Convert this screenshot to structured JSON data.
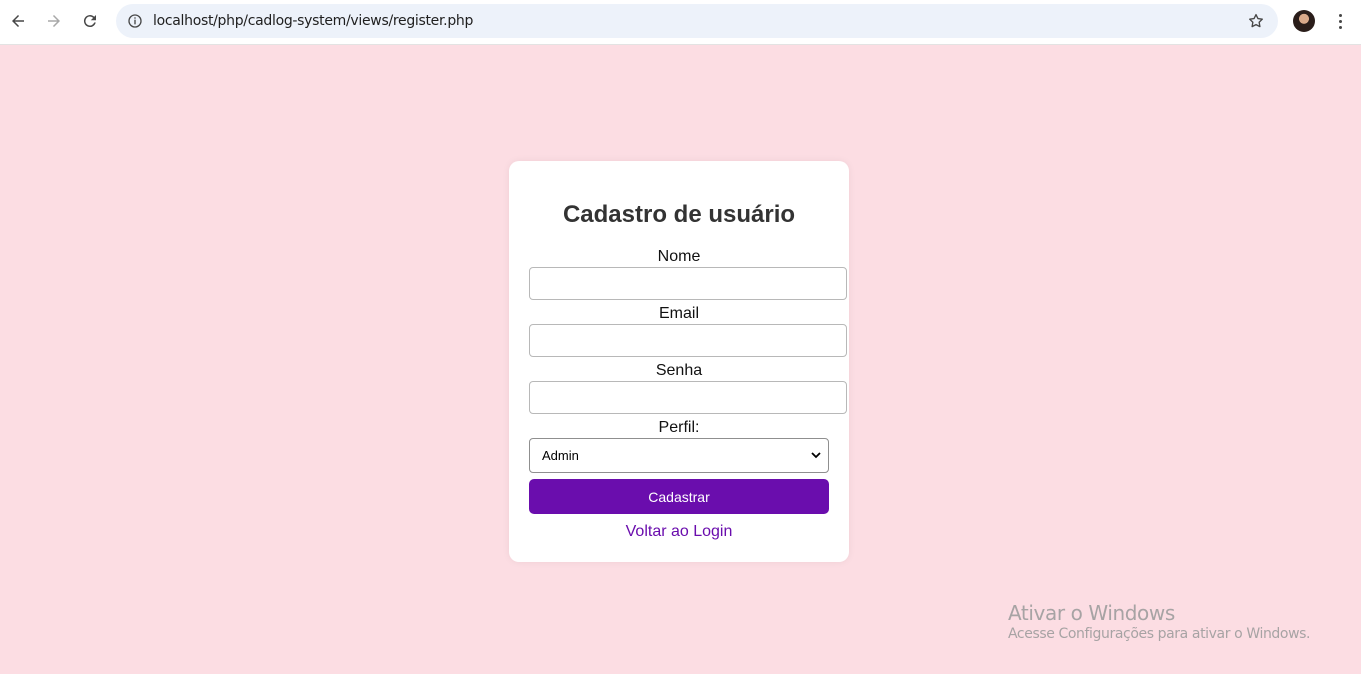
{
  "browser": {
    "url": "localhost/php/cadlog-system/views/register.php"
  },
  "form": {
    "title": "Cadastro de usuário",
    "name_label": "Nome",
    "name_value": "",
    "email_label": "Email",
    "email_value": "",
    "password_label": "Senha",
    "password_value": "",
    "profile_label": "Perfil:",
    "profile_selected": "Admin",
    "submit_label": "Cadastrar",
    "back_link": "Voltar ao Login"
  },
  "watermark": {
    "title": "Ativar o Windows",
    "subtitle": "Acesse Configurações para ativar o Windows."
  },
  "colors": {
    "page_background": "#fcdde3",
    "accent": "#6a0dad",
    "card_background": "#ffffff"
  },
  "icons": [
    "back-arrow-icon",
    "forward-arrow-icon",
    "reload-icon",
    "site-info-icon",
    "bookmark-star-icon",
    "profile-avatar",
    "more-menu-icon",
    "chevron-down-icon"
  ]
}
